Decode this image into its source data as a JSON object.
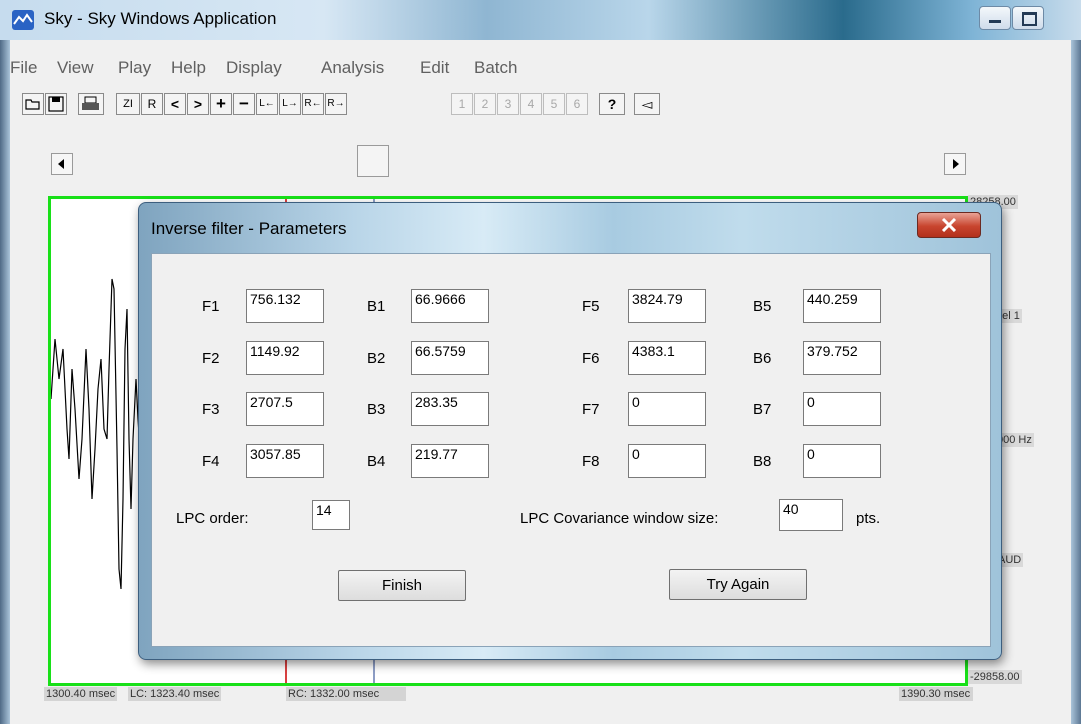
{
  "window": {
    "title": "Sky - Sky Windows Application"
  },
  "menu": [
    "File",
    "View",
    "Play",
    "Help",
    "Display",
    "Analysis",
    "Edit",
    "Batch"
  ],
  "toolbar": {
    "zoom_in": "ZI",
    "r": "R",
    "prev": "<",
    "next": ">",
    "plus": "+",
    "minus": "−",
    "l_left": "L←",
    "l_right": "L→",
    "r_left": "R←",
    "r_right": "R→",
    "channels": [
      "1",
      "2",
      "3",
      "4",
      "5",
      "6"
    ],
    "help_icon": "?",
    "speaker_icon": "◅"
  },
  "plot": {
    "right_labels": [
      "28258.00",
      "nel 1",
      "000 Hz",
      "AUD",
      "-29858.00"
    ],
    "bottom": {
      "start": "1300.40 msec",
      "lc": "LC: 1323.40 msec",
      "rc": "RC: 1332.00 msec",
      "end": "1390.30 msec"
    },
    "colors": {
      "frame": "#18e018",
      "cursor_left": "#cc0000",
      "cursor_right": "#1a3a8a"
    }
  },
  "dialog": {
    "title": "Inverse filter - Parameters",
    "formants": {
      "rows": [
        {
          "f": "F1",
          "fv": "756.132",
          "b": "B1",
          "bv": "66.9666",
          "f2": "F5",
          "f2v": "3824.79",
          "b2": "B5",
          "b2v": "440.259"
        },
        {
          "f": "F2",
          "fv": "1149.92",
          "b": "B2",
          "bv": "66.5759",
          "f2": "F6",
          "f2v": "4383.1",
          "b2": "B6",
          "b2v": "379.752"
        },
        {
          "f": "F3",
          "fv": "2707.5",
          "b": "B3",
          "bv": "283.35",
          "f2": "F7",
          "f2v": "0",
          "b2": "B7",
          "b2v": "0"
        },
        {
          "f": "F4",
          "fv": "3057.85",
          "b": "B4",
          "bv": "219.77",
          "f2": "F8",
          "f2v": "0",
          "b2": "B8",
          "b2v": "0"
        }
      ]
    },
    "lpc_order_label": "LPC order:",
    "lpc_order_value": "14",
    "cov_label": "LPC Covariance window size:",
    "cov_value": "40",
    "cov_unit": "pts.",
    "finish": "Finish",
    "try_again": "Try Again"
  }
}
